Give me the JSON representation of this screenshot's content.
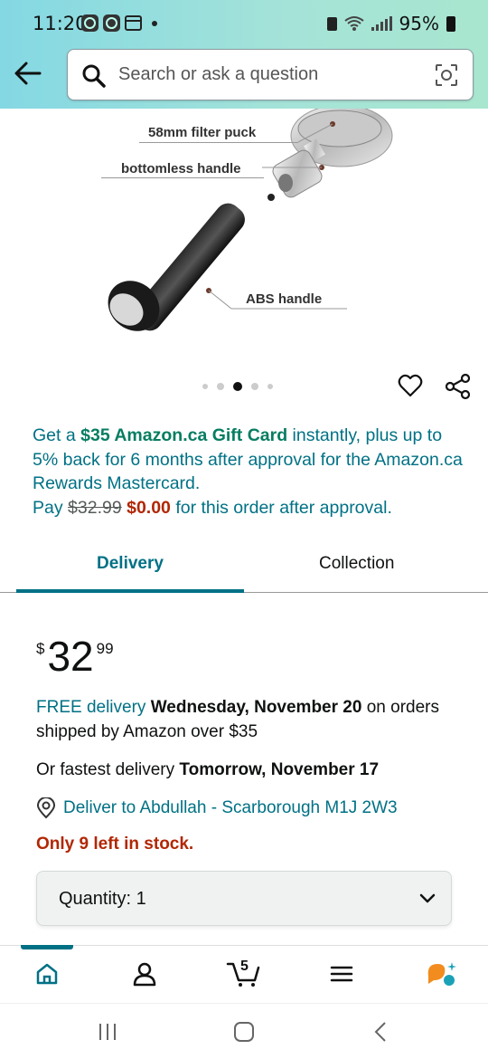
{
  "status_bar": {
    "time": "11:20",
    "battery": "95%"
  },
  "search": {
    "placeholder": "Search or ask a question"
  },
  "product_image": {
    "callouts": [
      "58mm filter puck",
      "bottomless handle",
      "ABS handle"
    ]
  },
  "carousel": {
    "count": 5,
    "active_index": 2
  },
  "promo": {
    "part1": "Get a ",
    "gift": "$35 Amazon.ca Gift Card",
    "part2": " instantly, plus up to 5% back for 6 months after approval for the Amazon.ca Rewards Mastercard.",
    "pay": "Pay ",
    "old_price": "$32.99",
    "new_price": "$0.00",
    "part3": " for this order after approval."
  },
  "tabs": {
    "delivery": "Delivery",
    "collection": "Collection",
    "selected": "Delivery"
  },
  "price": {
    "currency": "$",
    "whole": "32",
    "fraction": "99"
  },
  "delivery": {
    "free_label": "FREE delivery",
    "date": "Wednesday, November 20",
    "condition": " on orders shipped by Amazon over $35",
    "fastest_prefix": "Or fastest delivery ",
    "fastest_date": "Tomorrow, November 17",
    "deliver_to": "Deliver to Abdullah - Scarborough M1J 2W3"
  },
  "stock": "Only 9 left in stock.",
  "quantity": {
    "label": "Quantity:",
    "value": "1"
  },
  "bottom_nav": {
    "cart_count": "5"
  },
  "colors": {
    "teal": "#007185",
    "green": "#067d62",
    "red": "#b12704"
  }
}
